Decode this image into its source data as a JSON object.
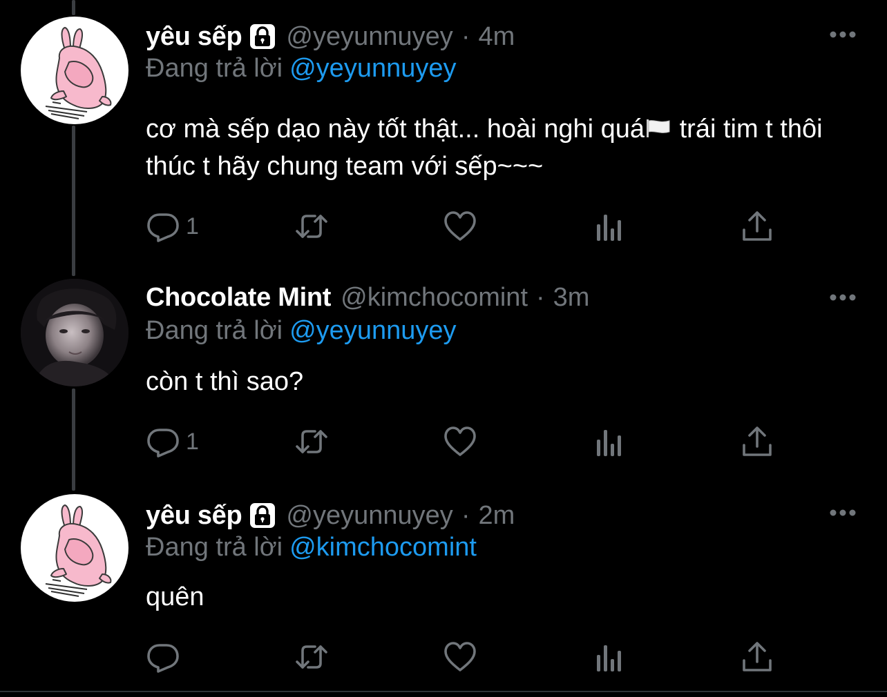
{
  "theme": {
    "background": "#000000",
    "text": "#ffffff",
    "secondary_text": "#71767b",
    "accent": "#1d9bf0",
    "thread_line": "#3a3d41"
  },
  "tweets": [
    {
      "display_name": "yêu sếp",
      "protected_icon": "lock-icon",
      "handle": "@yeyunnuyey",
      "separator": "·",
      "time": "4m",
      "reply_prefix": "Đang trả lời",
      "reply_to": "@yeyunnuyey",
      "text_before_emoji": "cơ mà sếp dạo này tốt thật... hoài nghi quá",
      "emoji": "white-flag-emoji",
      "text_after_emoji": " trái tim t thôi thúc t hãy chung team với sếp~~~",
      "avatar": "pink-bunny-avatar",
      "reply_count": "1"
    },
    {
      "display_name": "Chocolate Mint",
      "handle": "@kimchocomint",
      "separator": "·",
      "time": "3m",
      "reply_prefix": "Đang trả lời",
      "reply_to": "@yeyunnuyey",
      "text": "còn t thì sao?",
      "avatar": "photo-avatar",
      "reply_count": "1"
    },
    {
      "display_name": "yêu sếp",
      "protected_icon": "lock-icon",
      "handle": "@yeyunnuyey",
      "separator": "·",
      "time": "2m",
      "reply_prefix": "Đang trả lời",
      "reply_to": "@kimchocomint",
      "text": "quên",
      "avatar": "pink-bunny-avatar",
      "reply_count": ""
    }
  ],
  "action_icons": [
    "reply-icon",
    "retweet-icon",
    "like-icon",
    "analytics-icon",
    "share-icon"
  ],
  "menu_icon": "more-options-icon"
}
